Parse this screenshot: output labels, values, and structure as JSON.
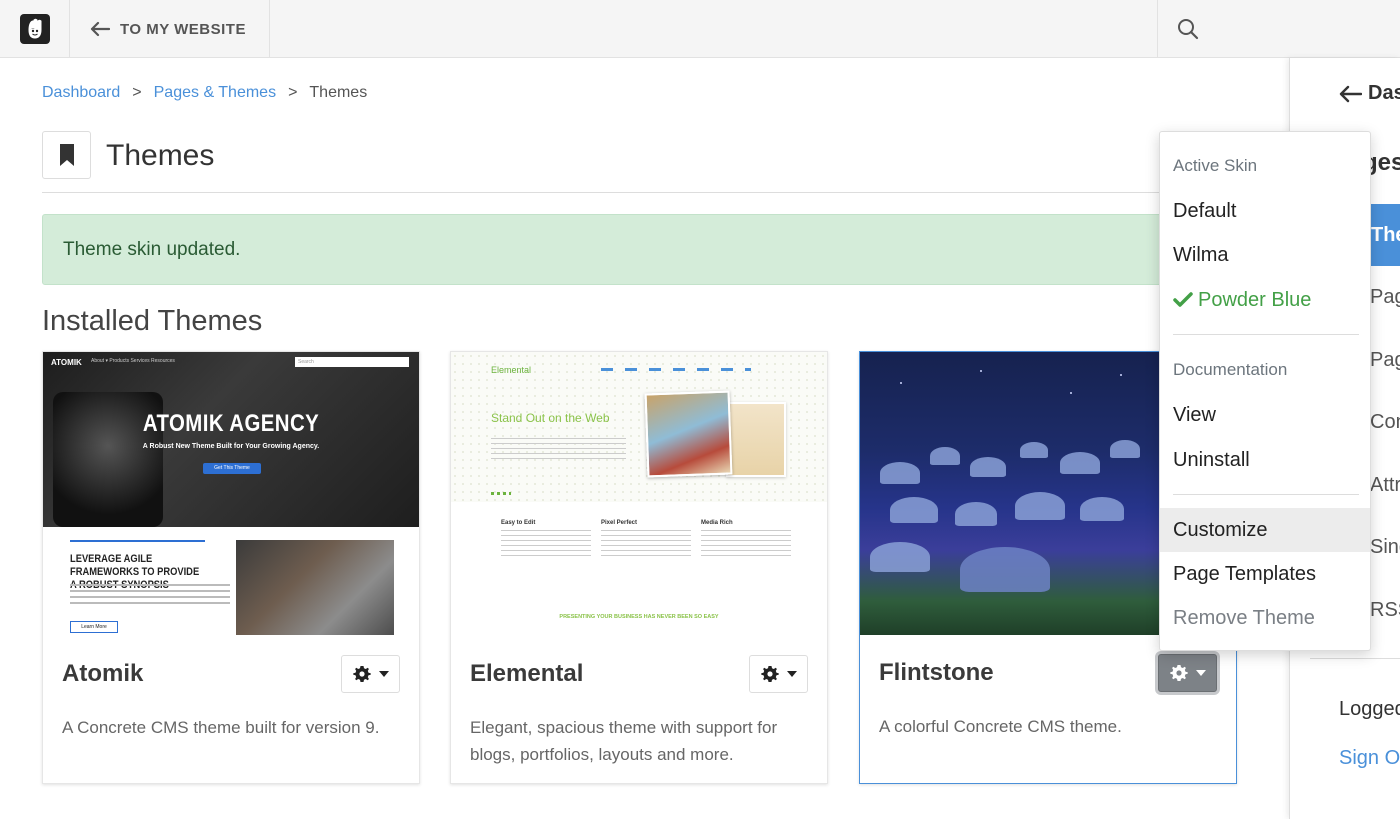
{
  "toolbar": {
    "back_label": "TO MY WEBSITE"
  },
  "breadcrumb": {
    "items": [
      "Dashboard",
      "Pages & Themes",
      "Themes"
    ],
    "separator": ">"
  },
  "header": {
    "title": "Themes"
  },
  "alert": {
    "message": "Theme skin updated."
  },
  "section": {
    "title": "Installed Themes"
  },
  "themes": [
    {
      "name": "Atomik",
      "description": "A Concrete CMS theme built for version 9.",
      "thumb": {
        "brand": "ATOMIK",
        "nav": "About ▾   Products   Services   Resources",
        "search_placeholder": "Search",
        "headline": "ATOMIK AGENCY",
        "tagline": "A Robust New Theme Built for Your Growing Agency.",
        "cta": "Get This Theme",
        "heading2": "LEVERAGE AGILE FRAMEWORKS TO PROVIDE A ROBUST SYNOPSIS",
        "learn_more": "Learn More"
      }
    },
    {
      "name": "Elemental",
      "description": "Elegant, spacious theme with support for blogs, portfolios, layouts and more.",
      "thumb": {
        "logo": "Elemental",
        "headline": "Stand Out on the Web",
        "features": [
          "Easy to Edit",
          "Pixel Perfect",
          "Media Rich"
        ],
        "footer_banner": "PRESENTING YOUR BUSINESS HAS NEVER BEEN SO EASY"
      }
    },
    {
      "name": "Flintstone",
      "description": "A colorful Concrete CMS theme.",
      "selected": true
    }
  ],
  "dropdown": {
    "skin_header": "Active Skin",
    "skins": [
      {
        "label": "Default",
        "checked": false
      },
      {
        "label": "Wilma",
        "checked": false
      },
      {
        "label": "Powder Blue",
        "checked": true
      }
    ],
    "docs_header": "Documentation",
    "docs_items": [
      "View",
      "Uninstall"
    ],
    "actions": [
      "Customize",
      "Page Templates",
      "Remove Theme"
    ]
  },
  "side_panel": {
    "back_label": "Das",
    "title": "ges",
    "active_item": "The",
    "items": [
      "Pag",
      "Pag",
      "Con",
      "Attr",
      "Sing",
      "RSS"
    ],
    "logged_in": "Logged",
    "sign_out": "Sign Ou"
  },
  "colors": {
    "link": "#4a90d9",
    "alert_bg": "#d4ecd9",
    "alert_text": "#2a5b34",
    "checked_green": "#43a047",
    "active_blue": "#4a90d9"
  }
}
